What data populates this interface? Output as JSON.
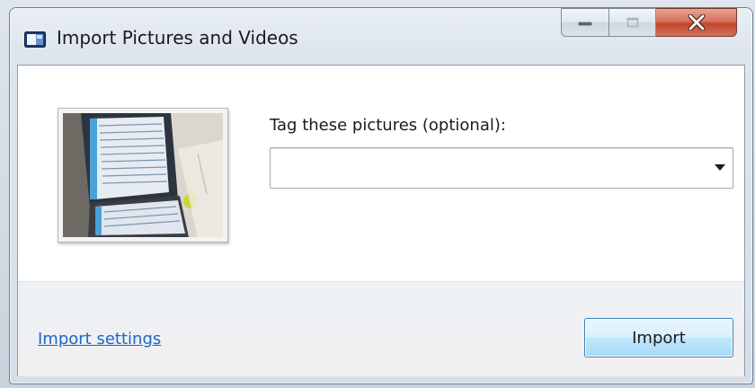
{
  "window": {
    "title": "Import Pictures and Videos",
    "icon": "import-pictures-icon",
    "controls": {
      "minimize_icon": "minimize-icon",
      "maximize_icon": "maximize-icon",
      "close_icon": "close-icon"
    }
  },
  "main": {
    "thumbnail_icon": "photo-thumbnail",
    "tag_label": "Tag these pictures (optional):",
    "tag_value": "",
    "dropdown_icon": "chevron-down-icon"
  },
  "footer": {
    "settings_link": "Import settings",
    "import_button": "Import"
  },
  "colors": {
    "link": "#1a66c9",
    "close_button": "#c2452c",
    "primary_button": "#bee6fd"
  }
}
